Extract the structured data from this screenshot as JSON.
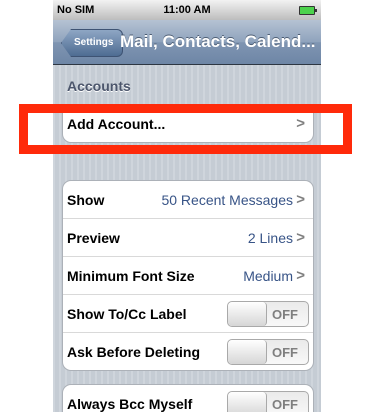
{
  "status_bar": {
    "carrier": "No SIM",
    "time": "11:00 AM"
  },
  "nav": {
    "back_label": "Settings",
    "title": "Mail, Contacts, Calend..."
  },
  "accounts": {
    "header": "Accounts",
    "add_account_label": "Add Account..."
  },
  "mail_settings": {
    "show": {
      "label": "Show",
      "value": "50 Recent Messages"
    },
    "preview": {
      "label": "Preview",
      "value": "2 Lines"
    },
    "min_font": {
      "label": "Minimum Font Size",
      "value": "Medium"
    },
    "show_tocc": {
      "label": "Show To/Cc Label",
      "state": "OFF"
    },
    "ask_delete": {
      "label": "Ask Before Deleting",
      "state": "OFF"
    }
  },
  "bcc": {
    "label": "Always Bcc Myself",
    "state": "OFF"
  },
  "chevron": ">",
  "highlight_color": "#ff2a0a"
}
